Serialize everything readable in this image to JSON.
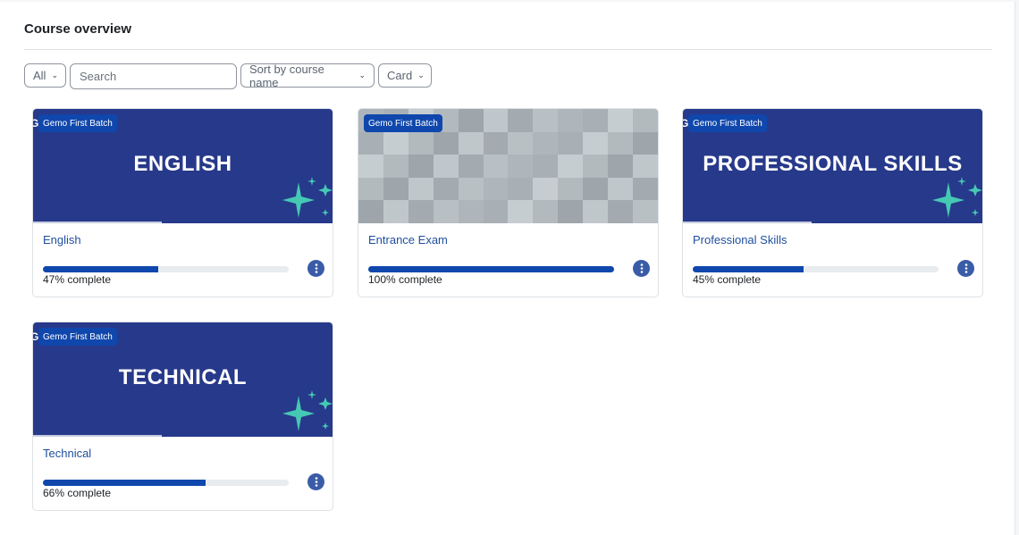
{
  "header": {
    "title": "Course overview"
  },
  "filters": {
    "grouping": {
      "label": "All"
    },
    "search": {
      "placeholder": "Search"
    },
    "sort": {
      "label": "Sort by course name"
    },
    "view": {
      "label": "Card"
    }
  },
  "courses": [
    {
      "name": "English",
      "banner_text": "ENGLISH",
      "category": "Gemo First Batch",
      "progress": 47,
      "progress_text": "47% complete",
      "image": "branded-banner"
    },
    {
      "name": "Entrance Exam",
      "banner_text": "",
      "category": "Gemo First Batch",
      "progress": 100,
      "progress_text": "100% complete",
      "image": "grey-mosaic-pattern"
    },
    {
      "name": "Professional Skills",
      "banner_text": "PROFESSIONAL SKILLS",
      "category": "Gemo First Batch",
      "progress": 45,
      "progress_text": "45% complete",
      "image": "branded-banner"
    },
    {
      "name": "Technical",
      "banner_text": "TECHNICAL",
      "category": "Gemo First Batch",
      "progress": 66,
      "progress_text": "66% complete",
      "image": "branded-banner"
    }
  ],
  "icons": {
    "chevron": "chevron-down-icon",
    "menu": "kebab-menu-icon",
    "sparkle": "sparkle-icon"
  },
  "colors": {
    "banner": "#27398a",
    "badge": "#0f47ad",
    "progress": "#0f47ad",
    "sparkle": "#45c9b4",
    "link": "#1f4e9f"
  }
}
